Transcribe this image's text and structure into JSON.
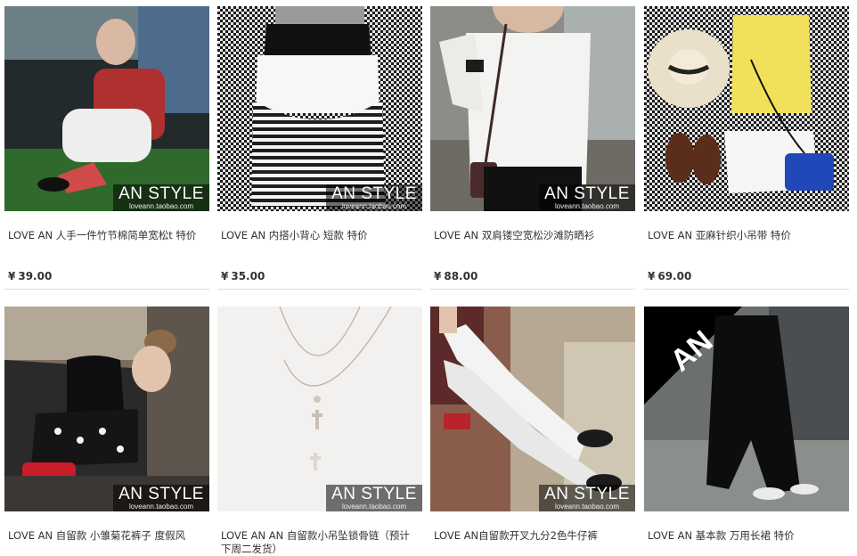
{
  "watermark": {
    "brand": "AN STYLE",
    "site": "loveann.taobao.com"
  },
  "currency": "¥",
  "products": [
    {
      "title": "LOVE AN 人手一件竹节棉简单宽松t 特价",
      "price": "39.00",
      "watermark": true
    },
    {
      "title": "LOVE AN 内搭小背心 短款 特价",
      "price": "35.00",
      "watermark": true
    },
    {
      "title": "LOVE AN 双肩镂空宽松沙滩防晒衫",
      "price": "88.00",
      "watermark": true
    },
    {
      "title": "LOVE AN 亚麻针织小吊带 特价",
      "price": "69.00",
      "watermark": false
    },
    {
      "title": "LOVE AN 自留款 小雏菊花裤子 度假风",
      "watermark": true
    },
    {
      "title": "LOVE AN AN 自留款小吊坠锁骨链（预计下周二发货）",
      "watermark": true
    },
    {
      "title": "LOVE AN自留款开叉九分2色牛仔裤",
      "watermark": true
    },
    {
      "title": "LOVE AN 基本款 万用长裙 特价",
      "watermark": false,
      "badge": "AN"
    }
  ]
}
